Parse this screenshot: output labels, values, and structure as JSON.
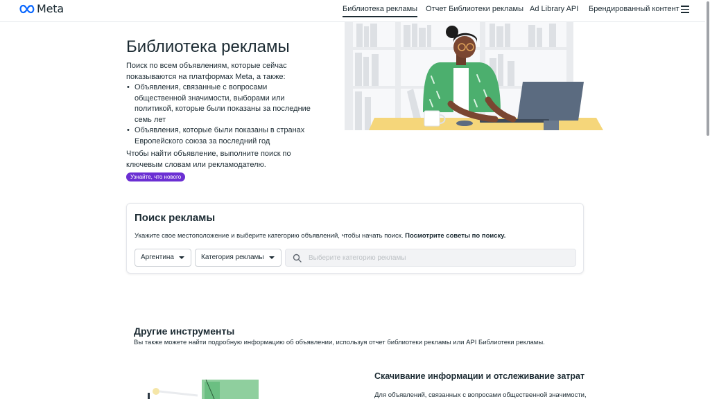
{
  "brand": {
    "name": "Meta"
  },
  "nav": {
    "items": [
      {
        "label": "Библиотека рекламы",
        "active": true
      },
      {
        "label": "Отчет Библиотеки рекламы",
        "active": false
      },
      {
        "label": "Ad Library API",
        "active": false
      },
      {
        "label": "Брендированный контент",
        "active": false
      }
    ],
    "menu_icon": "hamburger-menu-icon"
  },
  "hero": {
    "title": "Библиотека рекламы",
    "intro": "Поиск по всем объявлениям, которые сейчас показываются на платформах Meta, а также:",
    "bullets": [
      "Объявления, связанные с вопросами общественной значимости, выборами или политикой, которые были показаны за последние семь лет",
      "Объявления, которые были показаны в странах Европейского союза за последний год"
    ],
    "find_text": "Чтобы найти объявление, выполните поиск по ключевым словам или рекламодателю.",
    "badge": "Узнайте, что нового"
  },
  "search": {
    "title": "Поиск рекламы",
    "description": "Укажите свое местоположение и выберите категорию объявлений, чтобы начать поиск.",
    "tips_link": "Посмотрите советы по поиску.",
    "country": "Аргентина",
    "category": "Категория рекламы",
    "placeholder": "Выберите категорию рекламы"
  },
  "tools": {
    "title": "Другие инструменты",
    "description": "Вы также можете найти подробную информацию об объявлении, используя отчет библиотеки рекламы или API Библиотеки рекламы.",
    "download_title": "Скачивание информации и отслеживание затрат",
    "download_desc": "Для объявлений, связанных с вопросами общественной значимости,"
  },
  "colors": {
    "text": "#1c2b33",
    "badge": "#6b2fd3",
    "desk": "#f5d67a",
    "laptop": "#5b6b80",
    "sweater": "#4caf6e"
  }
}
